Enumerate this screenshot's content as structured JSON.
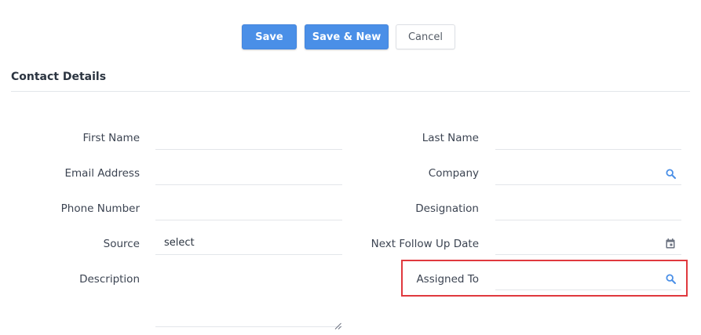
{
  "toolbar": {
    "save_label": "Save",
    "save_new_label": "Save & New",
    "cancel_label": "Cancel"
  },
  "section": {
    "title": "Contact Details"
  },
  "form": {
    "first_name": {
      "label": "First Name",
      "value": ""
    },
    "last_name": {
      "label": "Last Name",
      "value": ""
    },
    "email": {
      "label": "Email Address",
      "value": ""
    },
    "company": {
      "label": "Company",
      "value": "",
      "icon": "search-icon"
    },
    "phone": {
      "label": "Phone Number",
      "value": ""
    },
    "designation": {
      "label": "Designation",
      "value": ""
    },
    "source": {
      "label": "Source",
      "value": "select"
    },
    "next_follow_up": {
      "label": "Next Follow Up Date",
      "value": "",
      "icon": "calendar-icon"
    },
    "description": {
      "label": "Description",
      "value": ""
    },
    "assigned_to": {
      "label": "Assigned To",
      "value": "",
      "icon": "search-icon"
    }
  },
  "colors": {
    "primary": "#4a8fe7",
    "highlight": "#e0393e",
    "icon_blue": "#4a8fe7",
    "divider": "#e3e6ea"
  }
}
